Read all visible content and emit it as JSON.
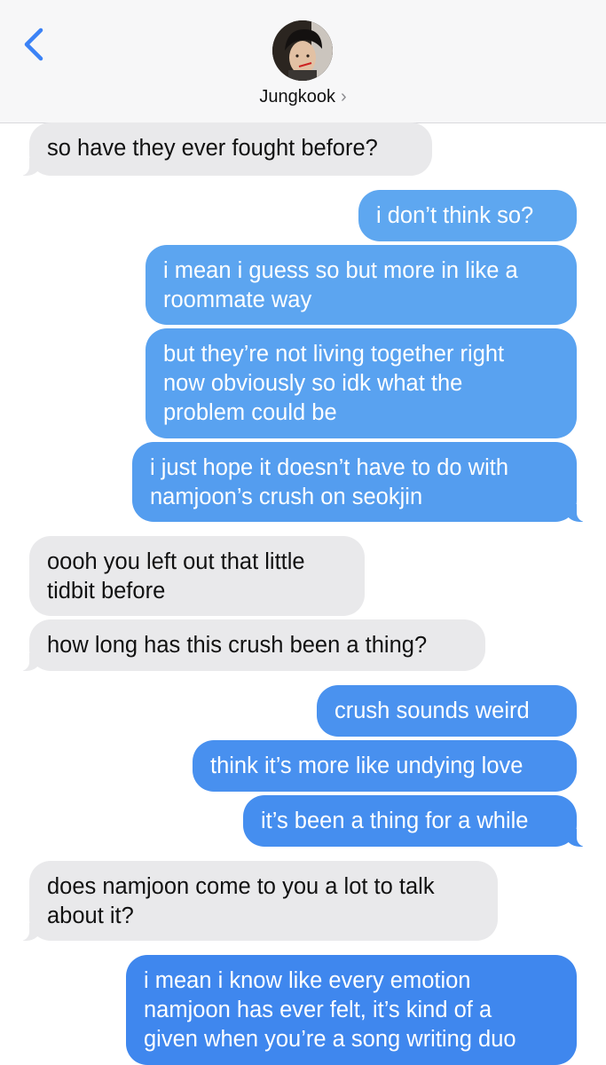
{
  "header": {
    "back_icon": "chevron-left-icon",
    "contact_name": "Jungkook",
    "contact_chevron": "›"
  },
  "colors": {
    "incoming": "#e9e9eb",
    "outgoing_light": "#5fa8f0",
    "outgoing_dark": "#3a82ee",
    "accent": "#3b82f6"
  },
  "messages": [
    {
      "from": "them",
      "lines": [
        "so have they ever fought before?"
      ]
    },
    {
      "from": "me",
      "lines": [
        "i don’t think so?"
      ]
    },
    {
      "from": "me",
      "lines": [
        "i mean i guess so but more in like a",
        "roommate way"
      ]
    },
    {
      "from": "me",
      "lines": [
        "but they’re not living together right",
        "now obviously so idk what the",
        "problem could be"
      ]
    },
    {
      "from": "me",
      "lines": [
        "i just hope it doesn’t have to do with",
        "namjoon’s crush on seokjin"
      ]
    },
    {
      "from": "them",
      "lines": [
        "oooh you left out that little",
        "tidbit before"
      ]
    },
    {
      "from": "them",
      "lines": [
        "how long has this crush been a thing?"
      ]
    },
    {
      "from": "me",
      "lines": [
        "crush sounds weird"
      ]
    },
    {
      "from": "me",
      "lines": [
        "think it’s more like undying love"
      ]
    },
    {
      "from": "me",
      "lines": [
        "it’s been a thing for a while"
      ]
    },
    {
      "from": "them",
      "lines": [
        "does namjoon come to you a lot to talk",
        "about it?"
      ]
    },
    {
      "from": "me",
      "lines": [
        "i mean i know like every emotion",
        "namjoon has ever felt, it’s kind of a",
        "given when you’re a song writing duo"
      ]
    }
  ]
}
